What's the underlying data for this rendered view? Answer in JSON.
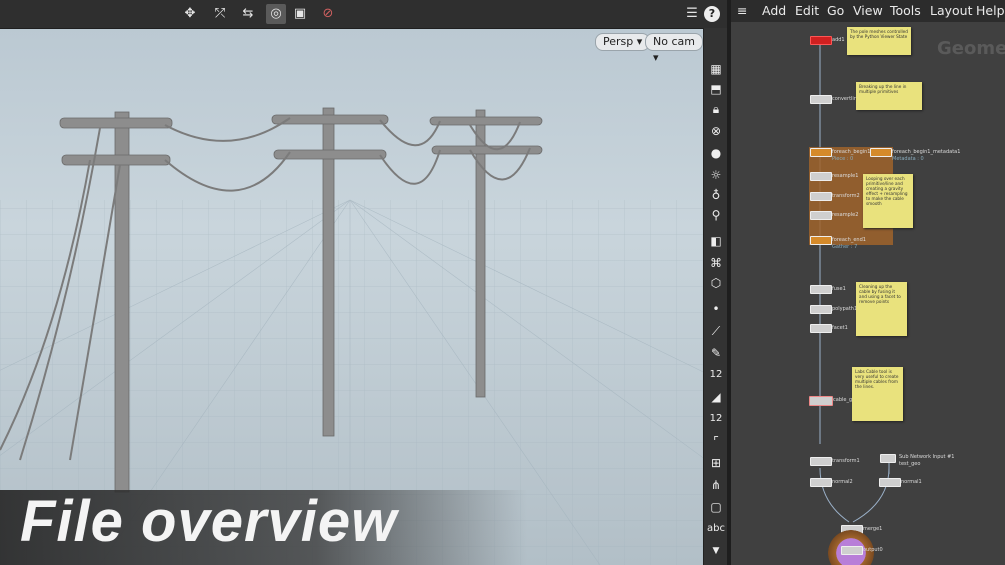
{
  "viewport": {
    "camera_view": "Persp",
    "camera": "No cam",
    "toolbar_icons": [
      "transform-tool-icon",
      "rotate-tool-icon",
      "scale-tool-icon",
      "snapping-icon",
      "display-options-icon",
      "ghost-icon"
    ],
    "help_glyph": "?"
  },
  "shelf": {
    "text_label": "abc",
    "number_glyph": "12"
  },
  "network": {
    "menu": [
      "Add",
      "Edit",
      "Go",
      "View",
      "Tools",
      "Layout",
      "Help"
    ],
    "context_title": "Geome",
    "nodes": [
      {
        "name": "add1",
        "sub": ""
      },
      {
        "name": "convertline1",
        "sub": ""
      },
      {
        "name": "foreach_begin1",
        "sub": "Piece : 0"
      },
      {
        "name": "foreach_begin1_metadata1",
        "sub": "Metadata : 0"
      },
      {
        "name": "resample1",
        "sub": ""
      },
      {
        "name": "transform2",
        "sub": ""
      },
      {
        "name": "resample2",
        "sub": ""
      },
      {
        "name": "foreach_end1",
        "sub": "Gather : 7"
      },
      {
        "name": "fuse1",
        "sub": ""
      },
      {
        "name": "polypath1",
        "sub": ""
      },
      {
        "name": "facet1",
        "sub": ""
      },
      {
        "name": "cable_generator1",
        "sub": ""
      },
      {
        "name": "transform1",
        "sub": ""
      },
      {
        "name": "Sub Network Input #1",
        "sub": "test_geo"
      },
      {
        "name": "normal2",
        "sub": ""
      },
      {
        "name": "normal1",
        "sub": ""
      },
      {
        "name": "merge1",
        "sub": ""
      },
      {
        "name": "output0",
        "sub": ""
      }
    ],
    "stickies": [
      "The pole meshes controlled by the Python Viewer State",
      "Breaking up the line in multiple primitives",
      "Looping over each primitive/line and creating a gravity effect + resampling to make the cable smooth",
      "Cleaning up the cable by fusing it and using a facet to remove points",
      "Labs Cable tool is very useful to create multiple cables from the lines."
    ]
  },
  "overlay": {
    "title": "File overview"
  },
  "colors": {
    "sticky": "#e9e27d",
    "loop": "#a0642c",
    "wire": "#9ab0c8",
    "output": "#b87ed8"
  }
}
